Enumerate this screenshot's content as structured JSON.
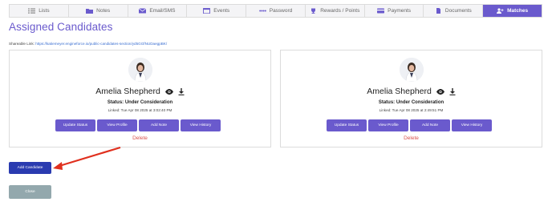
{
  "tabs": [
    {
      "label": "Lists",
      "icon": "list-icon"
    },
    {
      "label": "Notes",
      "icon": "folder-icon"
    },
    {
      "label": "Email/SMS",
      "icon": "envelope-icon"
    },
    {
      "label": "Events",
      "icon": "calendar-icon"
    },
    {
      "label": "Password",
      "icon": "password-dots-icon"
    },
    {
      "label": "Rewards / Points",
      "icon": "trophy-icon"
    },
    {
      "label": "Payments",
      "icon": "credit-card-icon"
    },
    {
      "label": "Documents",
      "icon": "document-icon"
    },
    {
      "label": "Matches",
      "icon": "user-plus-icon",
      "active": true
    }
  ],
  "page": {
    "title": "Assigned Candidates",
    "shareable_label": "Shareable Link:",
    "shareable_url": "https://katiemeyer.engineforce.io/public-candidates-section/yd5GGfNUDaegpBK/"
  },
  "candidates": [
    {
      "name": "Amelia Shepherd",
      "status": "Status: Under Consideration",
      "linked": "Linked: Tue Apr 08 2025 at 3:02:40 PM",
      "buttons": [
        "Update Status",
        "View Profile",
        "Add Note",
        "View History"
      ],
      "delete": "Delete"
    },
    {
      "name": "Amelia Shepherd",
      "status": "Status: Under Consideration",
      "linked": "Linked: Tue Apr 08 2025 at 2:49:51 PM",
      "buttons": [
        "Update Status",
        "View Profile",
        "Add Note",
        "View History"
      ],
      "delete": "Delete"
    }
  ],
  "actions": {
    "add_candidate": "Add Candidate",
    "close": "Close"
  },
  "colors": {
    "accent": "#6a5acd",
    "add_button": "#2a3bb0",
    "close_button": "#93a8ad",
    "delete": "#d9534f",
    "annotation_arrow": "#e0301e"
  }
}
